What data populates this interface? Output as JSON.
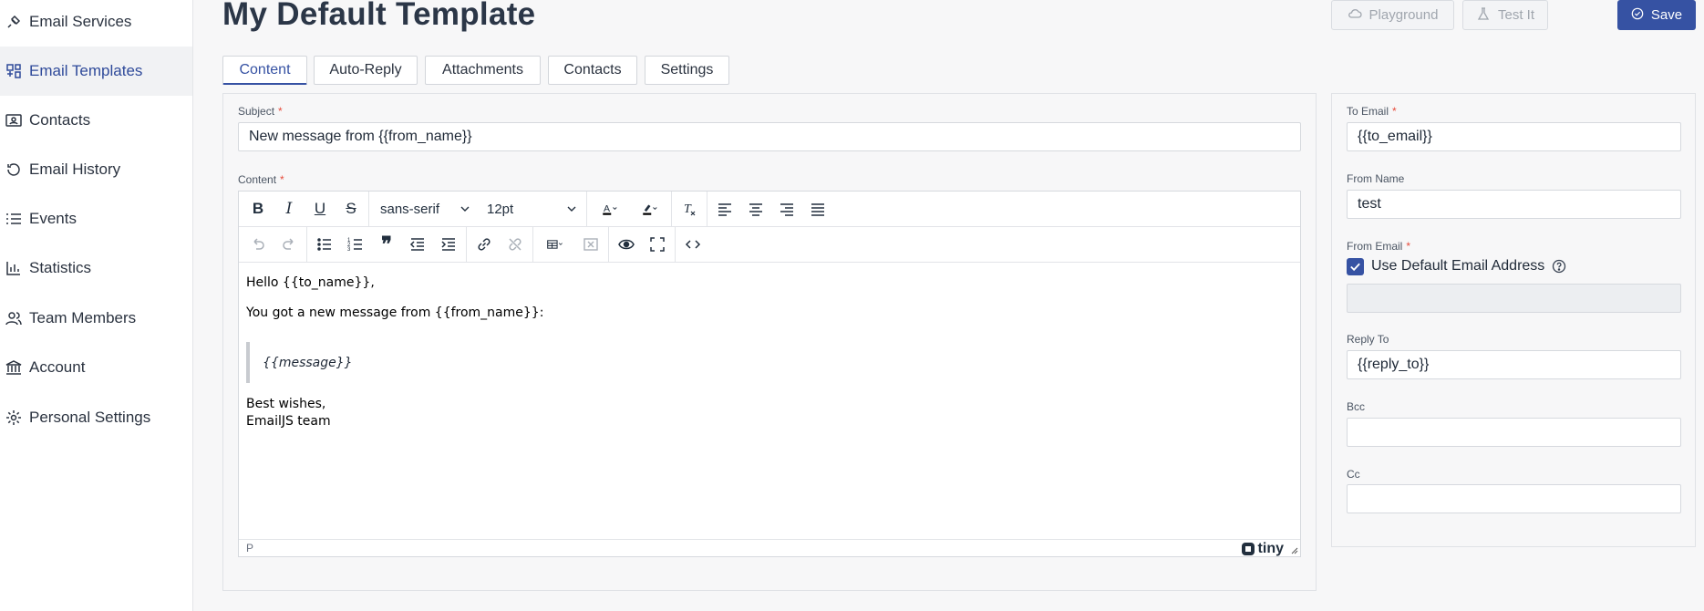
{
  "sidebar": {
    "items": [
      {
        "label": "Email Services",
        "icon": "plug-icon"
      },
      {
        "label": "Email Templates",
        "icon": "templates-icon"
      },
      {
        "label": "Contacts",
        "icon": "contacts-icon"
      },
      {
        "label": "Email History",
        "icon": "history-icon"
      },
      {
        "label": "Events",
        "icon": "list-icon"
      },
      {
        "label": "Statistics",
        "icon": "chart-icon"
      },
      {
        "label": "Team Members",
        "icon": "team-icon"
      },
      {
        "label": "Account",
        "icon": "bank-icon"
      },
      {
        "label": "Personal Settings",
        "icon": "gear-icon"
      }
    ],
    "active_index": 1
  },
  "header": {
    "title": "My Default Template",
    "playground_label": "Playground",
    "test_label": "Test It",
    "save_label": "Save"
  },
  "tabs": [
    {
      "label": "Content"
    },
    {
      "label": "Auto-Reply"
    },
    {
      "label": "Attachments"
    },
    {
      "label": "Contacts"
    },
    {
      "label": "Settings"
    }
  ],
  "content": {
    "subject_label": "Subject",
    "subject_value": "New message from {{from_name}}",
    "content_label": "Content",
    "required_mark": "*"
  },
  "editor": {
    "font_family": "sans-serif",
    "font_size": "12pt",
    "body": {
      "line1": "Hello {{to_name}},",
      "line2": "You got a new message from {{from_name}}:",
      "quote": "{{message}}",
      "line3": "Best wishes,",
      "line4": "EmailJS team"
    },
    "status_path": "P",
    "brand": "tiny"
  },
  "settings": {
    "to_email_label": "To Email",
    "to_email_value": "{{to_email}}",
    "from_name_label": "From Name",
    "from_name_value": "test",
    "from_email_label": "From Email",
    "use_default_label": "Use Default Email Address",
    "use_default_checked": true,
    "reply_to_label": "Reply To",
    "reply_to_value": "{{reply_to}}",
    "bcc_label": "Bcc",
    "bcc_value": "",
    "cc_label": "Cc",
    "cc_value": ""
  },
  "colors": {
    "accent": "#3652a3",
    "required": "#e74c3c"
  }
}
